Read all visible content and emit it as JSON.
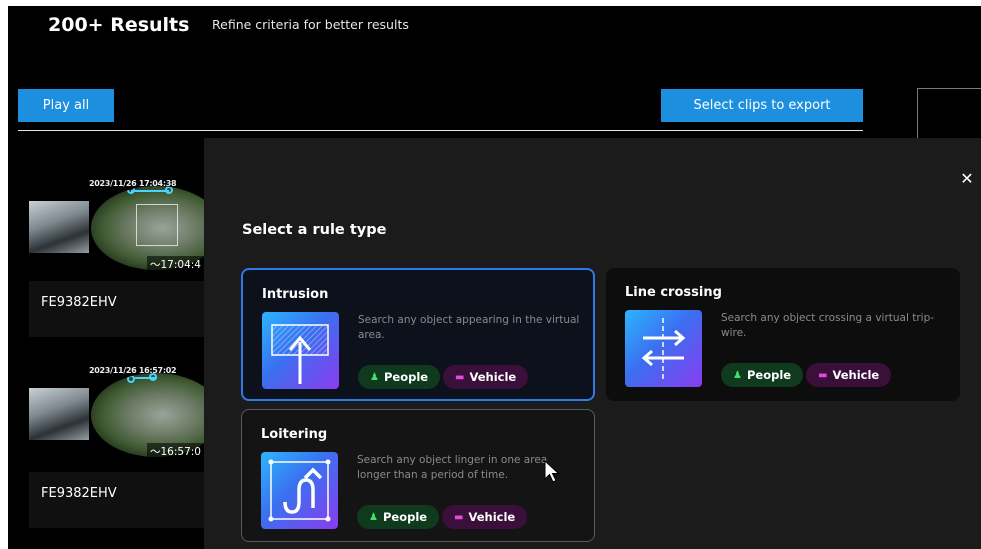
{
  "header": {
    "results_count": "200+ Results",
    "refine_hint": "Refine criteria for better results",
    "play_all_label": "Play all",
    "select_clips_label": "Select clips to export"
  },
  "results": [
    {
      "timestamp": "2023/11/26 17:04:38",
      "time": "17:04:4",
      "camera": "FE9382EHV"
    },
    {
      "timestamp": "2023/11/26 16:57:02",
      "time": "16:57:0",
      "camera": "FE9382EHV"
    }
  ],
  "modal": {
    "title": "Select a rule type",
    "close_icon": "close-icon",
    "rules": [
      {
        "name": "Intrusion",
        "description": "Search any object appearing in the virtual area.",
        "tags": [
          "People",
          "Vehicle"
        ],
        "icon": "intrusion-icon",
        "state": "selected"
      },
      {
        "name": "Line crossing",
        "description": "Search any object crossing a virtual trip-wire.",
        "tags": [
          "People",
          "Vehicle"
        ],
        "icon": "line-crossing-icon",
        "state": "normal"
      },
      {
        "name": "Loitering",
        "description": "Search any object linger in one area longer than a period of time.",
        "tags": [
          "People",
          "Vehicle"
        ],
        "icon": "loitering-icon",
        "state": "hover"
      }
    ]
  },
  "colors": {
    "accent_button": "#1c8fde",
    "selected_border": "#2d7be5",
    "people_tag": "#0f3a1d",
    "vehicle_tag": "#3a0f3a"
  }
}
